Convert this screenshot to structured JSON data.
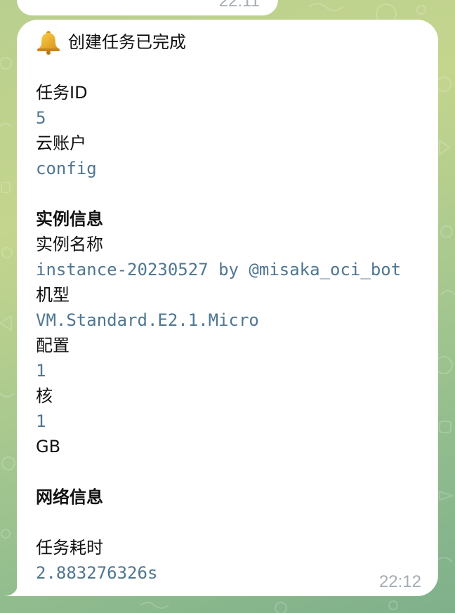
{
  "previous_message": {
    "time": "22:11"
  },
  "message": {
    "title": "创建任务已完成",
    "task_id_label": "任务ID",
    "task_id_value": "5",
    "cloud_account_label": "云账户",
    "cloud_account_value": "config",
    "instance_section": "实例信息",
    "instance_name_label": "实例名称",
    "instance_name_value": "instance-20230527 by @misaka_oci_bot",
    "shape_label": "机型",
    "shape_value": "VM.Standard.E2.1.Micro",
    "config_label": "配置",
    "cores_value": "1",
    "cores_unit": "核",
    "memory_value": "1",
    "memory_unit": "GB",
    "network_section": "网络信息",
    "duration_label": "任务耗时",
    "duration_value": "2.883276326s",
    "time": "22:12"
  },
  "icons": {
    "title_icon": "bell-icon"
  },
  "colors": {
    "bubble": "#ffffff",
    "mono_text": "#4f7691",
    "timestamp": "#a6adb3",
    "background_accent": "#a9c98f"
  }
}
